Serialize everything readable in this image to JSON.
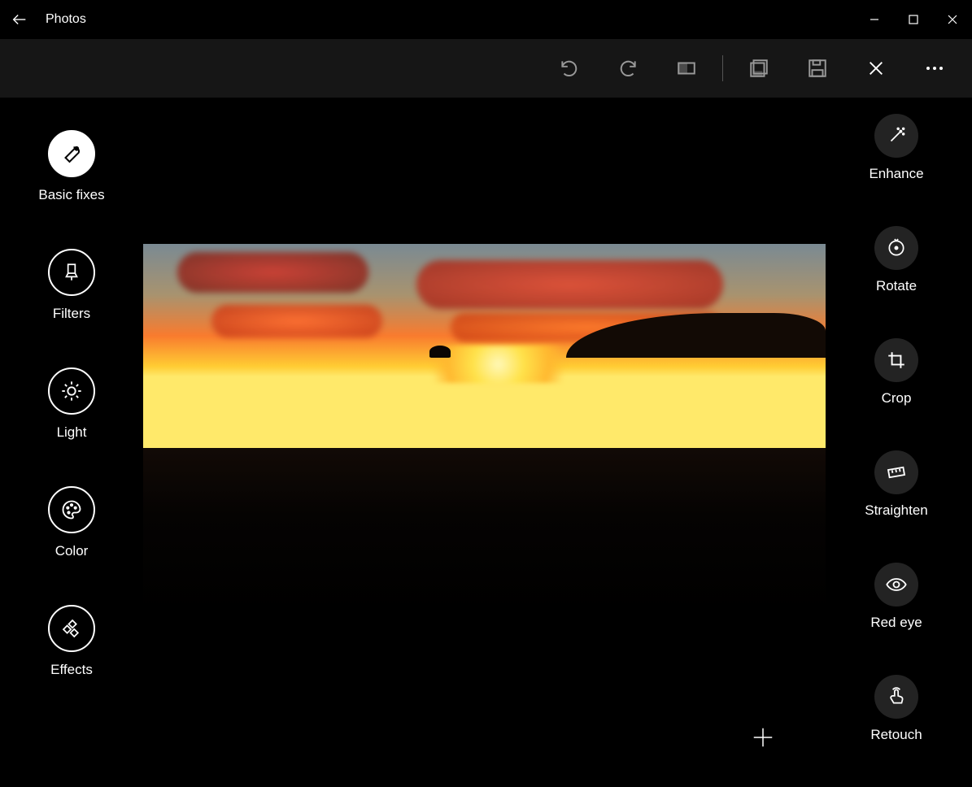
{
  "titlebar": {
    "title": "Photos"
  },
  "left": {
    "items": [
      {
        "label": "Basic fixes",
        "icon": "wrench",
        "selected": true
      },
      {
        "label": "Filters",
        "icon": "brush",
        "selected": false
      },
      {
        "label": "Light",
        "icon": "sun",
        "selected": false
      },
      {
        "label": "Color",
        "icon": "palette",
        "selected": false
      },
      {
        "label": "Effects",
        "icon": "sparkles",
        "selected": false
      }
    ]
  },
  "right": {
    "items": [
      {
        "label": "Enhance",
        "icon": "wand"
      },
      {
        "label": "Rotate",
        "icon": "rotate"
      },
      {
        "label": "Crop",
        "icon": "crop"
      },
      {
        "label": "Straighten",
        "icon": "straighten"
      },
      {
        "label": "Red eye",
        "icon": "eye"
      },
      {
        "label": "Retouch",
        "icon": "touch"
      }
    ]
  },
  "toolbar": {
    "undo": "Undo",
    "redo": "Redo",
    "compare": "Compare",
    "save_copy": "Save a copy",
    "save": "Save",
    "cancel": "Cancel",
    "more": "More"
  }
}
